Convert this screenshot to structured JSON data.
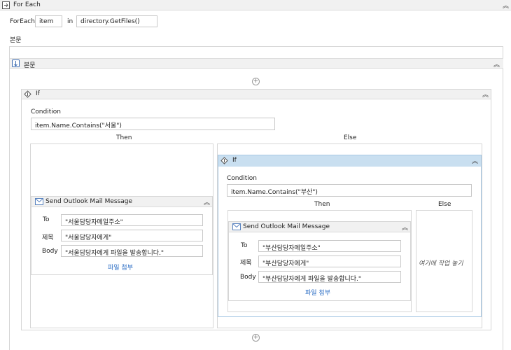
{
  "foreach": {
    "title": "For Each",
    "foreach_label": "ForEach",
    "item_value": "item",
    "in_label": "in",
    "collection_value": "directory.GetFiles()",
    "body_label": "본문"
  },
  "sequence": {
    "title": "본문"
  },
  "if1": {
    "title": "If",
    "condition_label": "Condition",
    "condition_value": "item.Name.Contains(\"서울\")",
    "then_label": "Then",
    "else_label": "Else"
  },
  "mail1": {
    "title": "Send Outlook Mail Message",
    "to_label": "To",
    "to_value": "\"서울담당자메일주소\"",
    "subject_label": "제목",
    "subject_value": "\"서울담당자에게\"",
    "body_label": "Body",
    "body_value": "\"서울담당자에게 파일을 발송합니다.\"",
    "attach_label": "파일 첨부"
  },
  "if2": {
    "title": "If",
    "condition_label": "Condition",
    "condition_value": "item.Name.Contains(\"부산\")",
    "then_label": "Then",
    "else_label": "Else",
    "drop_placeholder": "여기에 작업 놓기"
  },
  "mail2": {
    "title": "Send Outlook Mail Message",
    "to_label": "To",
    "to_value": "\"부산담당자메일주소\"",
    "subject_label": "제목",
    "subject_value": "\"부산담당자에게\"",
    "body_label": "Body",
    "body_value": "\"부산담당자에게 파일을 발송합니다.\"",
    "attach_label": "파일 첨부"
  },
  "icons": {
    "collapse": "︽",
    "add": "+"
  },
  "colors": {
    "selected_header": "#c9dff0",
    "link": "#2a6cc4"
  }
}
